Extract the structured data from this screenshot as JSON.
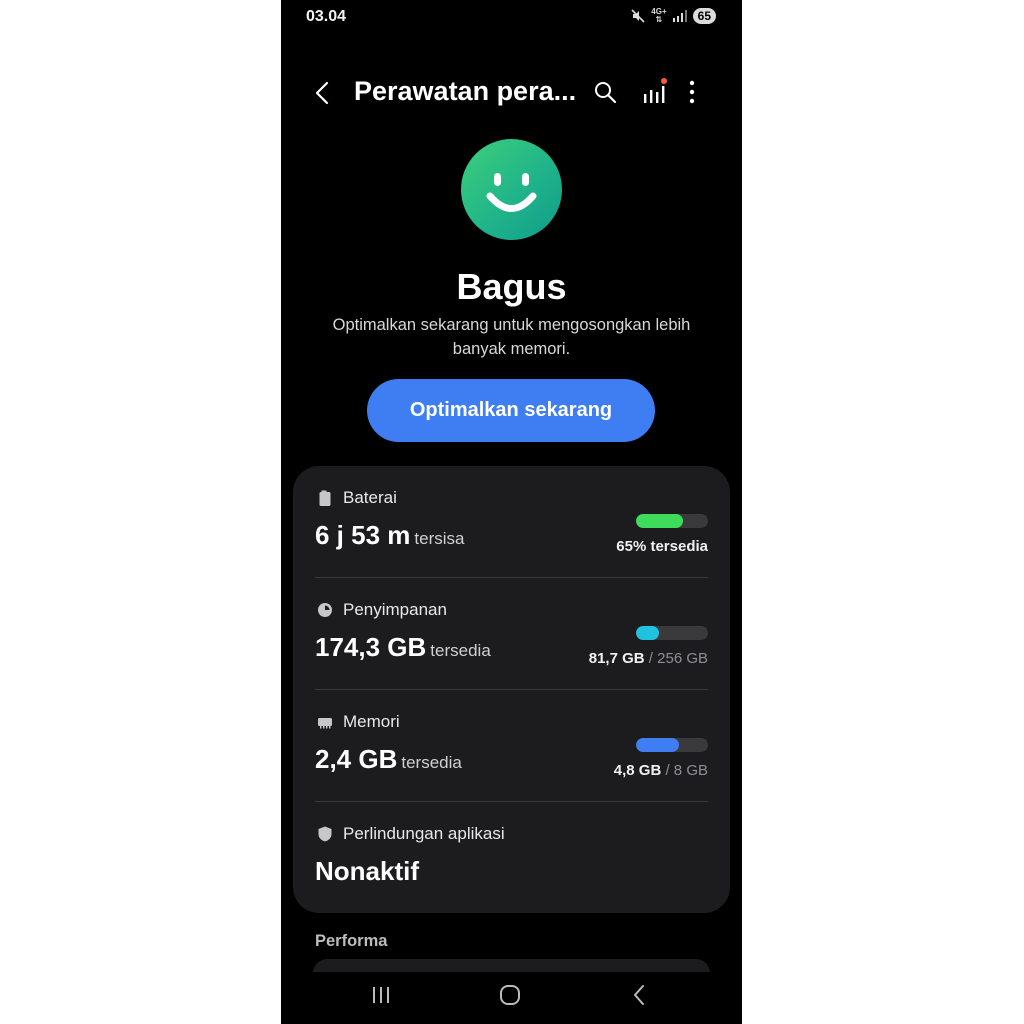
{
  "status_bar": {
    "time": "03.04",
    "network": "4G+",
    "battery_level": "65",
    "icons": [
      "mute-icon",
      "signal-icon"
    ]
  },
  "header": {
    "title": "Perawatan pera...",
    "actions": [
      "back-icon",
      "search-icon",
      "bar-chart-icon",
      "more-vert-icon"
    ]
  },
  "summary": {
    "status": "Bagus",
    "description": "Optimalkan sekarang untuk mengosongkan lebih banyak memori.",
    "optimize_label": "Optimalkan sekarang"
  },
  "items": [
    {
      "label": "Baterai",
      "icon": "battery-icon",
      "value": "6 j 53 m",
      "value_suffix": "tersisa",
      "caption_strong": "65% tersedia",
      "caption_rest": "",
      "fill": 0.65,
      "color": "#3ddc5b"
    },
    {
      "label": "Penyimpanan",
      "icon": "pie-chart-icon",
      "value": "174,3 GB",
      "value_suffix": "tersedia",
      "caption_strong": "81,7 GB",
      "caption_rest": "/ 256 GB",
      "fill": 0.32,
      "color": "#1fc3e0"
    },
    {
      "label": "Memori",
      "icon": "chip-icon",
      "value": "2,4 GB",
      "value_suffix": "tersedia",
      "caption_strong": "4,8 GB",
      "caption_rest": "/ 8 GB",
      "fill": 0.6,
      "color": "#3f7df2"
    },
    {
      "label": "Perlindungan aplikasi",
      "icon": "shield-icon",
      "value": "Nonaktif",
      "value_suffix": ""
    }
  ],
  "section": {
    "title": "Performa"
  },
  "navbar": [
    "recent-apps-icon",
    "home-icon",
    "back-nav-icon"
  ]
}
